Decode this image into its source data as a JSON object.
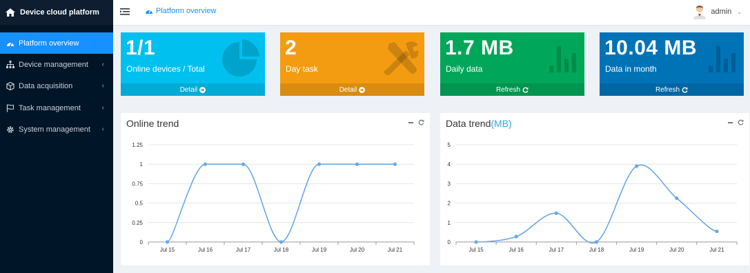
{
  "app": {
    "title": "Device cloud platform"
  },
  "sidebar": {
    "items": [
      {
        "label": "Platform overview",
        "icon": "dashboard-icon",
        "active": true
      },
      {
        "label": "Device management",
        "icon": "sitemap-icon",
        "active": false
      },
      {
        "label": "Data acquisition",
        "icon": "cube-icon",
        "active": false
      },
      {
        "label": "Task management",
        "icon": "flag-icon",
        "active": false
      },
      {
        "label": "System management",
        "icon": "gear-icon",
        "active": false
      }
    ]
  },
  "header": {
    "breadcrumb": "Platform overview",
    "breadcrumb_icon": "dashboard-icon",
    "user": "admin"
  },
  "stats": [
    {
      "value": "1/1",
      "label": "Online devices / Total",
      "action": "Detail",
      "color": "#00c0ef",
      "icon": "pie-chart-icon"
    },
    {
      "value": "2",
      "label": "Day task",
      "action": "Detail",
      "color": "#f39c12",
      "icon": "tools-icon"
    },
    {
      "value": "1.7 MB",
      "label": "Daily data",
      "action": "Refresh",
      "color": "#00a65a",
      "icon": "bar-chart-icon"
    },
    {
      "value": "10.04 MB",
      "label": "Data in month",
      "action": "Refresh",
      "color": "#0073b7",
      "icon": "bar-chart-icon"
    }
  ],
  "panels": {
    "online": {
      "title": "Online trend"
    },
    "data": {
      "title": "Data trend",
      "unit": "(MB)"
    }
  },
  "chart_data": [
    {
      "type": "line",
      "title": "Online trend",
      "categories": [
        "Jul 15",
        "Jul 16",
        "Jul 17",
        "Jul 18",
        "Jul 19",
        "Jul 20",
        "Jul 21"
      ],
      "values": [
        0,
        1,
        1,
        0,
        1,
        1,
        1
      ],
      "yticks": [
        "0",
        "0.25",
        "0.5",
        "0.75",
        "1",
        "1.25"
      ],
      "ylim": [
        0,
        1.25
      ],
      "grid": true,
      "color": "#67a9e8"
    },
    {
      "type": "line",
      "title": "Data trend(MB)",
      "categories": [
        "Jul 15",
        "Jul 16",
        "Jul 17",
        "Jul 18",
        "Jul 19",
        "Jul 20",
        "Jul 21"
      ],
      "values": [
        0,
        0.28,
        1.48,
        0,
        3.9,
        2.25,
        0.55
      ],
      "yticks": [
        "0",
        "1",
        "2",
        "3",
        "4",
        "5"
      ],
      "ylim": [
        0,
        5
      ],
      "grid": true,
      "color": "#67a9e8"
    }
  ]
}
